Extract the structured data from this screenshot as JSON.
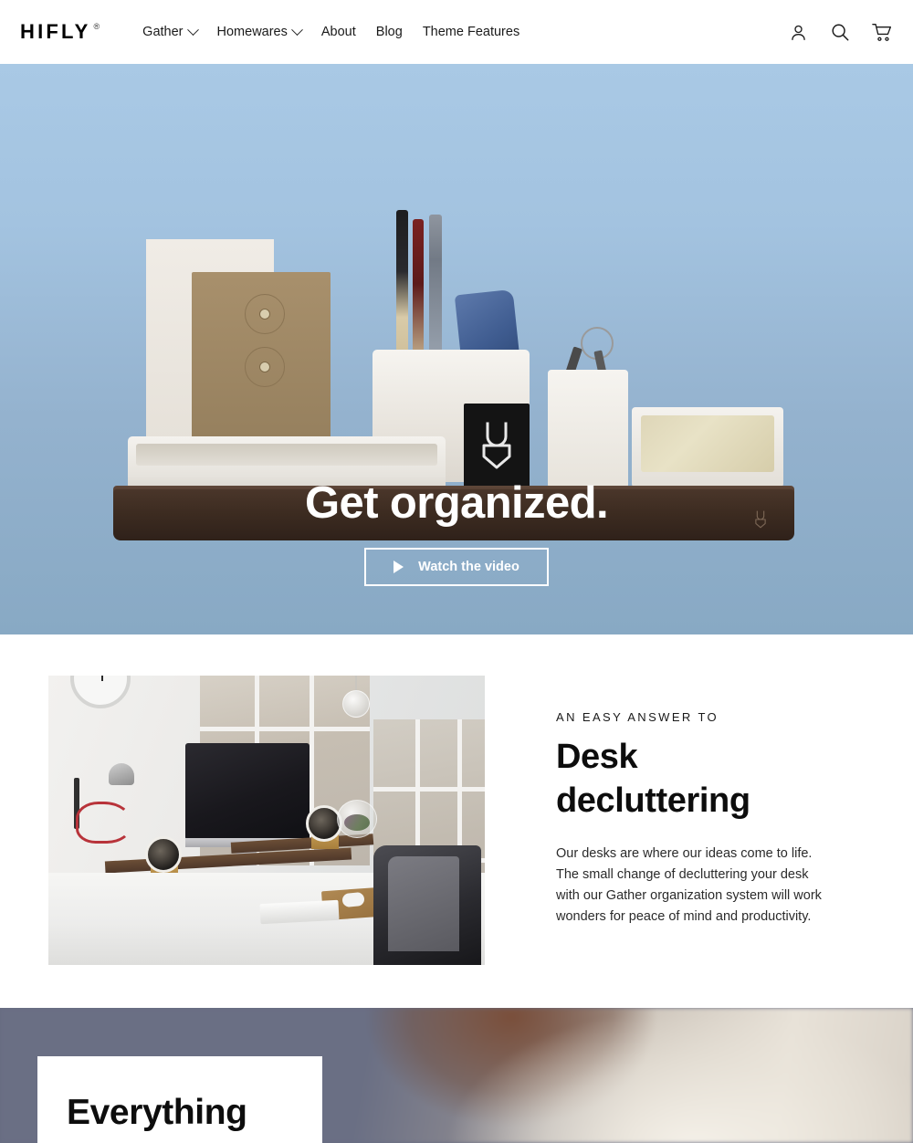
{
  "header": {
    "brand": {
      "word": "HIFLY",
      "registered": "®"
    },
    "nav": [
      {
        "label": "Gather",
        "has_dropdown": true
      },
      {
        "label": "Homewares",
        "has_dropdown": true
      },
      {
        "label": "About",
        "has_dropdown": false
      },
      {
        "label": "Blog",
        "has_dropdown": false
      },
      {
        "label": "Theme Features",
        "has_dropdown": false
      }
    ],
    "actions": [
      {
        "name": "account-icon",
        "label": "Account"
      },
      {
        "name": "search-icon",
        "label": "Search"
      },
      {
        "name": "cart-icon",
        "label": "Cart"
      }
    ]
  },
  "hero": {
    "title": "Get organized.",
    "button_label": "Watch the video",
    "bg_top": "#a9c9e5",
    "bg_bottom": "#88a9c4"
  },
  "feature": {
    "eyebrow": "AN EASY ANSWER TO",
    "title": "Desk decluttering",
    "body": "Our desks are where our ideas come to life. The small change of decluttering your desk with our Gather organization system will work wonders for peace of mind and productivity."
  },
  "bottom": {
    "title": "Everything",
    "bg": "#666b80"
  }
}
